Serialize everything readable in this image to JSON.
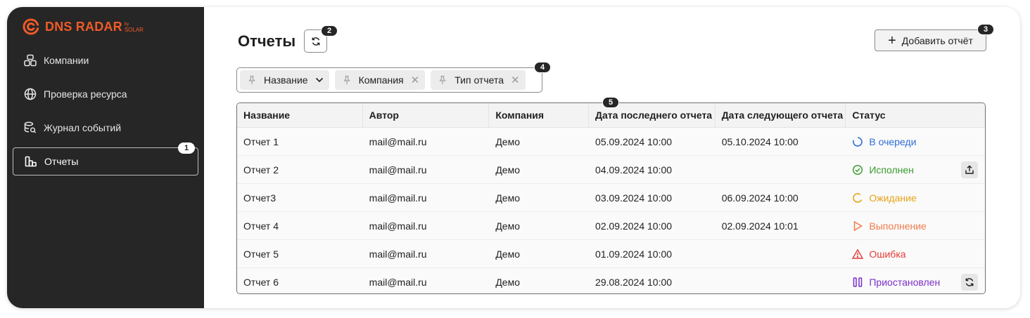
{
  "app": {
    "brand": "DNS RADAR",
    "brand_by": "by",
    "brand_sub": "SOLAR",
    "accent": "#f05a28"
  },
  "sidebar": {
    "items": [
      {
        "label": "Компании",
        "icon": "companies-icon"
      },
      {
        "label": "Проверка ресурса",
        "icon": "globe-icon"
      },
      {
        "label": "Журнал событий",
        "icon": "database-search-icon"
      },
      {
        "label": "Отчеты",
        "icon": "reports-icon",
        "active": true
      }
    ]
  },
  "markers": {
    "m1": "1",
    "m2": "2",
    "m3": "3",
    "m4": "4",
    "m5": "5"
  },
  "header": {
    "title": "Отчеты",
    "add_label": "Добавить отчёт"
  },
  "filters": [
    {
      "label": "Название",
      "kind": "dropdown"
    },
    {
      "label": "Компания",
      "kind": "removable"
    },
    {
      "label": "Тип отчета",
      "kind": "removable"
    }
  ],
  "table": {
    "columns": [
      "Название",
      "Автор",
      "Компания",
      "Дата последнего отчета",
      "Дата следующего отчета",
      "Статус"
    ],
    "rows": [
      {
        "name": "Отчет 1",
        "author": "mail@mail.ru",
        "company": "Демо",
        "last": "05.09.2024 10:00",
        "next": "05.10.2024 10:00",
        "status": "В очереди",
        "status_color": "#2f6fd6",
        "status_icon": "queue-icon"
      },
      {
        "name": "Отчет 2",
        "author": "mail@mail.ru",
        "company": "Демо",
        "last": "04.09.2024 10:00",
        "next": "",
        "status": "Исполнен",
        "status_color": "#3a9b2e",
        "status_icon": "check-circle-icon",
        "action": "export-icon"
      },
      {
        "name": "Отчет3",
        "author": "mail@mail.ru",
        "company": "Демо",
        "last": "03.09.2024 10:00",
        "next": "06.09.2024 10:00",
        "status": "Ожидание",
        "status_color": "#e8a317",
        "status_icon": "waiting-icon"
      },
      {
        "name": "Отчет 4",
        "author": "mail@mail.ru",
        "company": "Демо",
        "last": "02.09.2024 10:00",
        "next": "02.09.2024 10:01",
        "status": "Выполнение",
        "status_color": "#f07a4a",
        "status_icon": "play-icon"
      },
      {
        "name": "Отчет 5",
        "author": "mail@mail.ru",
        "company": "Демо",
        "last": "01.09.2024 10:00",
        "next": "",
        "status": "Ошибка",
        "status_color": "#e53935",
        "status_icon": "warning-icon"
      },
      {
        "name": "Отчет 6",
        "author": "mail@mail.ru",
        "company": "Демо",
        "last": "29.08.2024 10:00",
        "next": "",
        "status": "Приостановлен",
        "status_color": "#7b2fc9",
        "status_icon": "pause-icon",
        "action": "refresh-icon"
      }
    ]
  }
}
